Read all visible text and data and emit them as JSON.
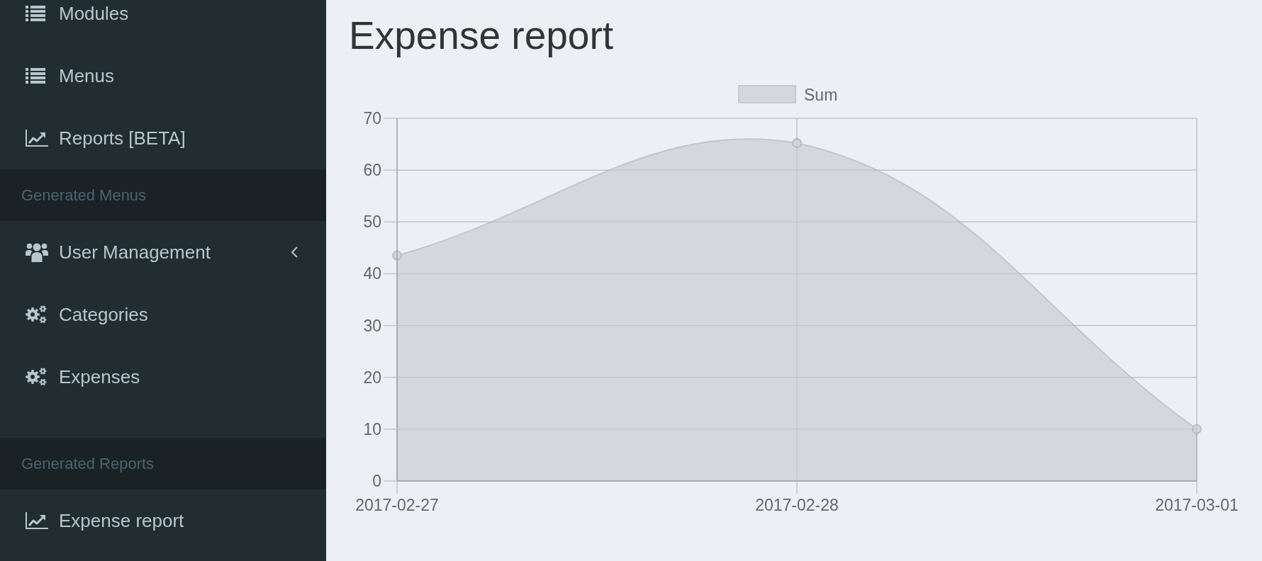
{
  "sidebar": {
    "sections": [
      {
        "items": [
          {
            "label": "Modules",
            "kind": "link"
          },
          {
            "label": "Menus",
            "kind": "link"
          },
          {
            "label": "Reports [BETA]",
            "kind": "link"
          }
        ]
      },
      {
        "header": "Generated Menus",
        "items": [
          {
            "label": "User Management",
            "kind": "tree",
            "expanded": false
          },
          {
            "label": "Categories",
            "kind": "link"
          },
          {
            "label": "Expenses",
            "kind": "link"
          }
        ]
      },
      {
        "header": "Generated Reports",
        "items": [
          {
            "label": "Expense report",
            "kind": "link"
          }
        ]
      }
    ]
  },
  "page": {
    "title": "Expense report",
    "chart_data": {
      "type": "area",
      "categories": [
        "2017-02-27",
        "2017-02-28",
        "2017-03-01"
      ],
      "series": [
        {
          "name": "Sum",
          "color": "#d4d7dc",
          "values": [
            43.5,
            65.2,
            10
          ]
        }
      ],
      "ylim": [
        0,
        70
      ],
      "yticks": [
        0,
        10,
        20,
        30,
        40,
        50,
        60,
        70
      ],
      "grid": true
    }
  }
}
